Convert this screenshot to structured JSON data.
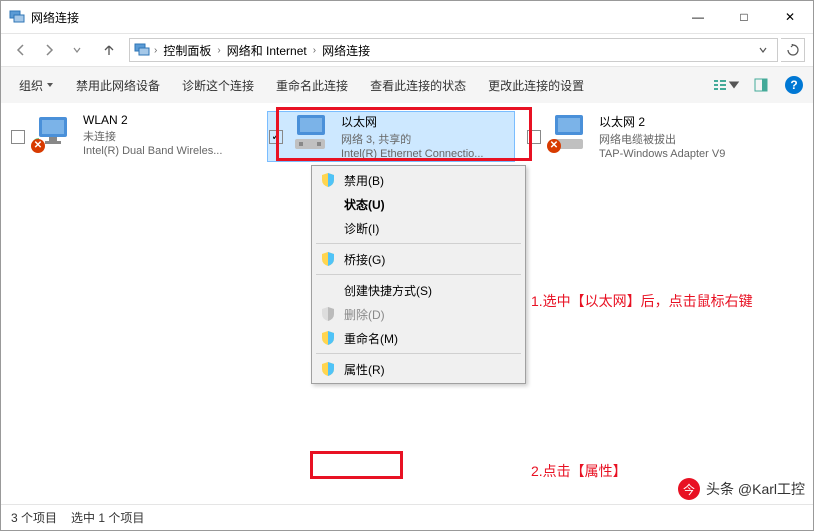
{
  "window": {
    "title": "网络连接",
    "minimize": "—",
    "maximize": "□",
    "close": "✕"
  },
  "breadcrumb": {
    "items": [
      "控制面板",
      "网络和 Internet",
      "网络连接"
    ]
  },
  "toolbar": {
    "organize": "组织",
    "disable": "禁用此网络设备",
    "diagnose": "诊断这个连接",
    "rename": "重命名此连接",
    "status": "查看此连接的状态",
    "settings": "更改此连接的设置"
  },
  "adapters": [
    {
      "name": "WLAN 2",
      "status": "未连接",
      "desc": "Intel(R) Dual Band Wireles...",
      "error": true,
      "selected": false,
      "checked": false
    },
    {
      "name": "以太网",
      "status": "网络 3, 共享的",
      "desc": "Intel(R) Ethernet Connectio...",
      "error": false,
      "selected": true,
      "checked": true
    },
    {
      "name": "以太网 2",
      "status": "网络电缆被拔出",
      "desc": "TAP-Windows Adapter V9",
      "error": true,
      "selected": false,
      "checked": false
    }
  ],
  "menu": {
    "disable": "禁用(B)",
    "status": "状态(U)",
    "diagnose": "诊断(I)",
    "bridge": "桥接(G)",
    "shortcut": "创建快捷方式(S)",
    "delete": "删除(D)",
    "rename": "重命名(M)",
    "properties": "属性(R)"
  },
  "annotations": {
    "a1": "1.选中【以太网】后，点击鼠标右键",
    "a2": "2.点击【属性】"
  },
  "statusbar": {
    "count": "3 个项目",
    "selected": "选中 1 个项目"
  },
  "watermark": "头条 @Karl工控"
}
